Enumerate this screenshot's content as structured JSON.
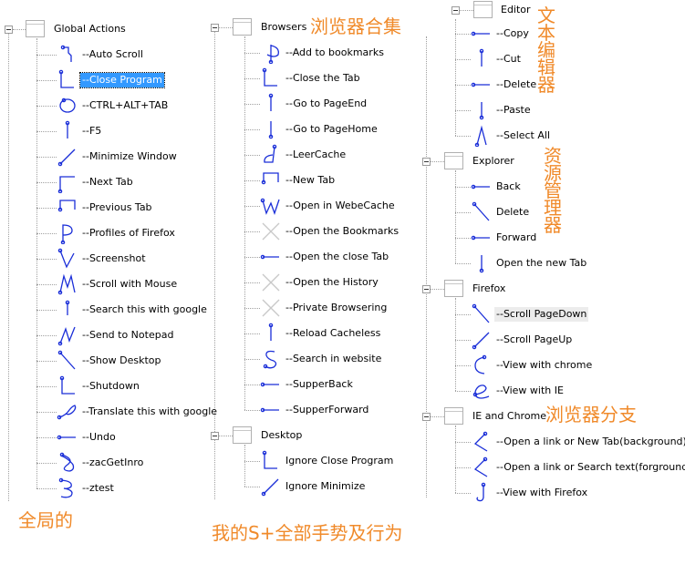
{
  "colors": {
    "accent": "#f08a2a",
    "selection": "#3399ff",
    "gesture": "#1a2ed8"
  },
  "global": {
    "title": "Global Actions",
    "items": [
      {
        "label": "--Auto Scroll",
        "icon": "gesture-down-right-down-icon"
      },
      {
        "label": "--Close Program",
        "icon": "gesture-down-right-icon",
        "selected": true
      },
      {
        "label": "--CTRL+ALT+TAB",
        "icon": "gesture-circle-icon"
      },
      {
        "label": "--F5",
        "icon": "gesture-down-icon"
      },
      {
        "label": "--Minimize Window",
        "icon": "gesture-up-right-icon"
      },
      {
        "label": "--Next Tab",
        "icon": "gesture-up-right-hook-icon"
      },
      {
        "label": "--Previous Tab",
        "icon": "gesture-up-right-down-icon"
      },
      {
        "label": "--Profiles of Firefox",
        "icon": "gesture-p-icon"
      },
      {
        "label": "--Screenshot",
        "icon": "gesture-v-icon"
      },
      {
        "label": "--Scroll with Mouse",
        "icon": "gesture-m-icon"
      },
      {
        "label": "--Search this with google",
        "icon": "gesture-short-down-icon"
      },
      {
        "label": "--Send to Notepad",
        "icon": "gesture-n-icon"
      },
      {
        "label": "--Show Desktop",
        "icon": "gesture-down-diagonal-icon"
      },
      {
        "label": "--Shutdown",
        "icon": "gesture-down-right-l-icon"
      },
      {
        "label": "--Translate this with google",
        "icon": "gesture-curl-icon"
      },
      {
        "label": "--Undo",
        "icon": "gesture-left-icon"
      },
      {
        "label": "--zacGetInro",
        "icon": "gesture-x-loop-icon"
      },
      {
        "label": "--ztest",
        "icon": "gesture-3-icon"
      }
    ]
  },
  "browsers": {
    "title": "Browsers",
    "items": [
      {
        "label": "--Add to bookmarks",
        "icon": "gesture-d-icon"
      },
      {
        "label": "--Close the Tab",
        "icon": "gesture-down-right-icon"
      },
      {
        "label": "--Go to PageEnd",
        "icon": "gesture-down-icon"
      },
      {
        "label": "--Go to PageHome",
        "icon": "gesture-up-icon"
      },
      {
        "label": "--LeerCache",
        "icon": "gesture-a-icon"
      },
      {
        "label": "--New Tab",
        "icon": "gesture-up-right-down-icon"
      },
      {
        "label": "--Open in WebeCache",
        "icon": "gesture-w-icon"
      },
      {
        "label": "--Open the Bookmarks",
        "icon": "gesture-none-icon"
      },
      {
        "label": "--Open the close Tab",
        "icon": "gesture-left-icon"
      },
      {
        "label": "--Open the History",
        "icon": "gesture-none-icon"
      },
      {
        "label": "--Private Browsering",
        "icon": "gesture-none-icon"
      },
      {
        "label": "--Reload Cacheless",
        "icon": "gesture-down-icon"
      },
      {
        "label": "--Search in  website",
        "icon": "gesture-s-icon"
      },
      {
        "label": "--SupperBack",
        "icon": "gesture-left-icon"
      },
      {
        "label": "--SupperForward",
        "icon": "gesture-right-icon"
      }
    ]
  },
  "desktop": {
    "title": "Desktop",
    "items": [
      {
        "label": "Ignore Close Program",
        "icon": "gesture-down-right-icon"
      },
      {
        "label": "Ignore Minimize",
        "icon": "gesture-up-right-icon"
      }
    ]
  },
  "editor": {
    "title": "Editor",
    "items": [
      {
        "label": "--Copy",
        "icon": "gesture-right-icon"
      },
      {
        "label": "--Cut",
        "icon": "gesture-down-icon"
      },
      {
        "label": "--Delete",
        "icon": "gesture-right-icon"
      },
      {
        "label": "--Paste",
        "icon": "gesture-up-icon"
      },
      {
        "label": "--Select All",
        "icon": "gesture-up-down-icon"
      }
    ]
  },
  "explorer": {
    "title": "Explorer",
    "items": [
      {
        "label": "Back",
        "icon": "gesture-left-icon"
      },
      {
        "label": "Delete",
        "icon": "gesture-down-diagonal-icon"
      },
      {
        "label": "Forward",
        "icon": "gesture-right-icon"
      },
      {
        "label": "Open the new Tab",
        "icon": "gesture-up-icon"
      }
    ]
  },
  "firefox": {
    "title": "Firefox",
    "items": [
      {
        "label": "--Scroll PageDown",
        "icon": "gesture-down-diagonal-icon",
        "hover": true
      },
      {
        "label": "--Scroll PageUp",
        "icon": "gesture-up-right-icon"
      },
      {
        "label": "--View with chrome",
        "icon": "gesture-c-icon"
      },
      {
        "label": "--View with IE",
        "icon": "gesture-e-icon"
      }
    ]
  },
  "iechrome": {
    "title": "IE and Chrome",
    "items": [
      {
        "label": "--Open a link or New Tab(background)",
        "icon": "gesture-left-down-right-icon"
      },
      {
        "label": "--Open a link or Search text(forground)",
        "icon": "gesture-left-down-right-icon"
      },
      {
        "label": "--View with Firefox",
        "icon": "gesture-j-icon"
      }
    ]
  },
  "annotations": {
    "browsers_collection": "浏览器合集",
    "text_editor": "文本编辑器",
    "resource_manager": "资源管理器",
    "browser_branch": "浏览器分支",
    "global": "全局的",
    "footer": "我的S+全部手势及行为"
  }
}
